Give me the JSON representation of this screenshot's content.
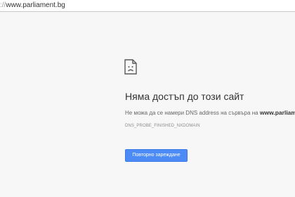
{
  "browser": {
    "address_scheme": "://",
    "address_host": "www.parliament.bg"
  },
  "error_page": {
    "icon": "sad-page-icon",
    "title": "Няма достъп до този сайт",
    "detail_prefix": "Не можа да се намери DNS address на сървъра на ",
    "detail_domain": "www.parliament.bg",
    "error_code": "DNS_PROBE_FINISHED_NXDOMAIN",
    "reload_label": "Повторно зареждане",
    "accent_color": "#4c8bf5"
  }
}
